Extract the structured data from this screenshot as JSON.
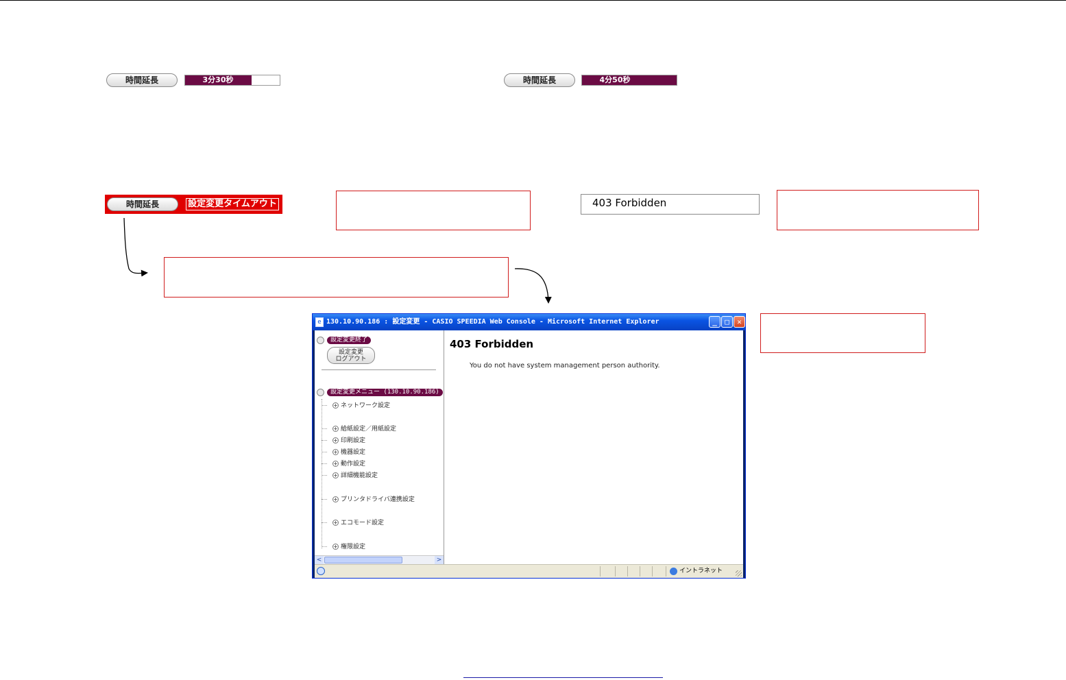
{
  "timers": {
    "extend_label": "時間延長",
    "timer1": {
      "text": "3分30秒",
      "fraction_remaining": 0.7
    },
    "timer2": {
      "text": "4分50秒",
      "fraction_remaining": 1.0
    },
    "timeout": {
      "text": "設定変更タイムアウト"
    }
  },
  "forbidden_panel": {
    "text": "403 Forbidden"
  },
  "browser": {
    "title": "130.10.90.186 : 設定変更 - CASIO SPEEDIA Web Console - Microsoft Internet Explorer",
    "window_buttons": {
      "minimize": "_",
      "maximize": "□",
      "close": "✕"
    },
    "left_frame": {
      "end_pill": "設定変更終了",
      "logout_button": {
        "line1": "設定変更",
        "line2": "ログアウト"
      },
      "menu_pill": "設定変更メニュー (130.10.90.186)",
      "menu_items": [
        "ネットワーク設定",
        "給紙設定／用紙設定",
        "印刷設定",
        "機器設定",
        "動作設定",
        "詳細機能設定",
        "プリンタドライバ連携設定",
        "エコモード設定",
        "権限設定"
      ],
      "scroll_labels": {
        "left": "<",
        "center": "|||",
        "right": ">"
      }
    },
    "content": {
      "heading": "403 Forbidden",
      "message": "You do not have system management person authority."
    },
    "status": {
      "zone": "イントラネット"
    }
  },
  "colors": {
    "accent": "#6b0b44",
    "alert": "#e00000",
    "callout_border": "#d01c1c",
    "titlebar": "#0a54e3"
  }
}
